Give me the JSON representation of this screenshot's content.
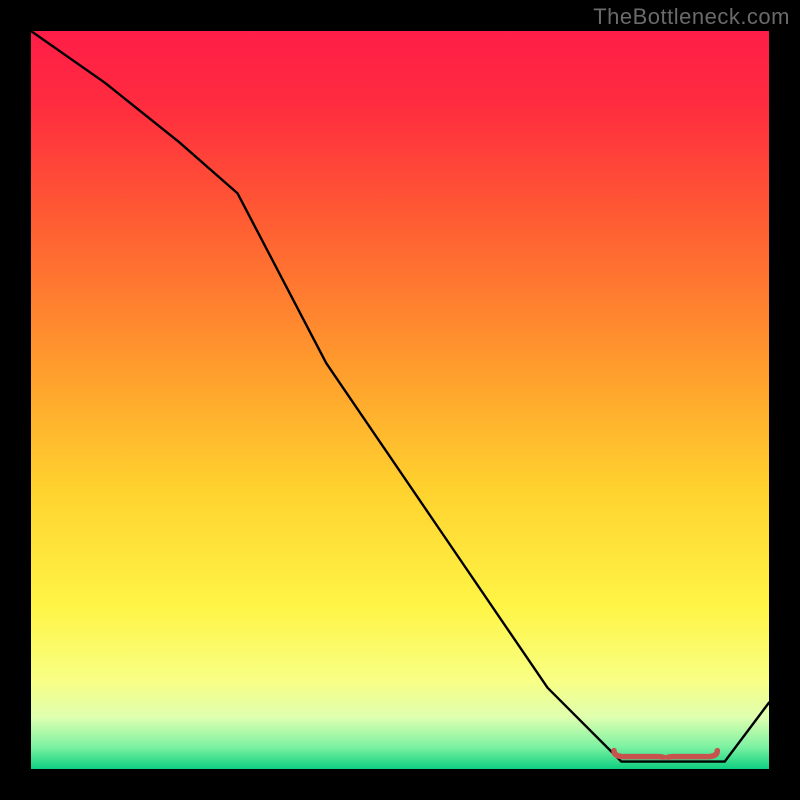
{
  "watermark": "TheBottleneck.com",
  "chart_data": {
    "type": "line",
    "title": "",
    "xlabel": "",
    "ylabel": "",
    "xlim": [
      0,
      100
    ],
    "ylim": [
      0,
      100
    ],
    "grid": false,
    "legend": false,
    "background": "red-yellow-green vertical gradient",
    "series": [
      {
        "name": "curve",
        "x": [
          0,
          10,
          20,
          28,
          40,
          55,
          70,
          80,
          82,
          85,
          88,
          91,
          94,
          100
        ],
        "y": [
          100,
          93,
          85,
          78,
          55,
          33,
          11,
          1,
          1,
          1,
          1,
          1,
          1,
          9
        ]
      }
    ],
    "annotations": [
      {
        "name": "red-bracket",
        "shape": "horizontal-brace",
        "approx_x_range": [
          79,
          93
        ],
        "approx_y": 1
      }
    ],
    "gradient_stops": [
      {
        "pos": 0.0,
        "color": "#ff1d48"
      },
      {
        "pos": 0.1,
        "color": "#ff2c3f"
      },
      {
        "pos": 0.25,
        "color": "#ff5a33"
      },
      {
        "pos": 0.45,
        "color": "#ff9a2d"
      },
      {
        "pos": 0.62,
        "color": "#ffd22e"
      },
      {
        "pos": 0.78,
        "color": "#fff546"
      },
      {
        "pos": 0.88,
        "color": "#f8ff84"
      },
      {
        "pos": 0.93,
        "color": "#dfffb0"
      },
      {
        "pos": 0.97,
        "color": "#7cf2a2"
      },
      {
        "pos": 1.0,
        "color": "#0ecf80"
      }
    ]
  }
}
